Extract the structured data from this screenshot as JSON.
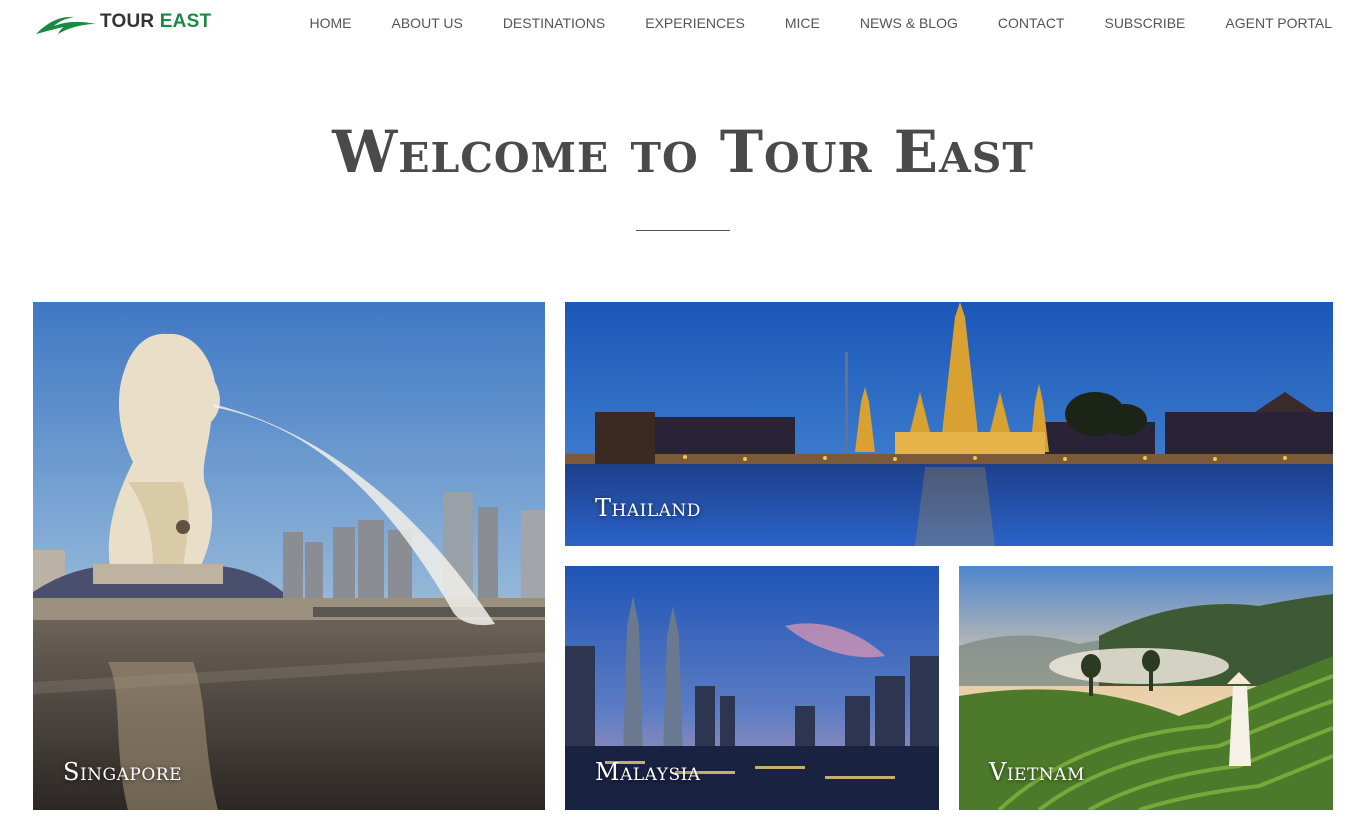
{
  "brand": {
    "logo_word_1": "TOUR",
    "logo_word_2": "EAST",
    "logo_color": "#1a8a43"
  },
  "nav": {
    "items": [
      {
        "label": "HOME"
      },
      {
        "label": "ABOUT US"
      },
      {
        "label": "DESTINATIONS"
      },
      {
        "label": "EXPERIENCES"
      },
      {
        "label": "MICE"
      },
      {
        "label": "NEWS & BLOG"
      },
      {
        "label": "CONTACT"
      },
      {
        "label": "SUBSCRIBE"
      },
      {
        "label": "AGENT PORTAL"
      }
    ]
  },
  "hero": {
    "title": "Welcome to Tour East"
  },
  "destinations": {
    "singapore": {
      "label": "Singapore"
    },
    "thailand": {
      "label": "Thailand"
    },
    "malaysia": {
      "label": "Malaysia"
    },
    "vietnam": {
      "label": "Vietnam"
    }
  }
}
